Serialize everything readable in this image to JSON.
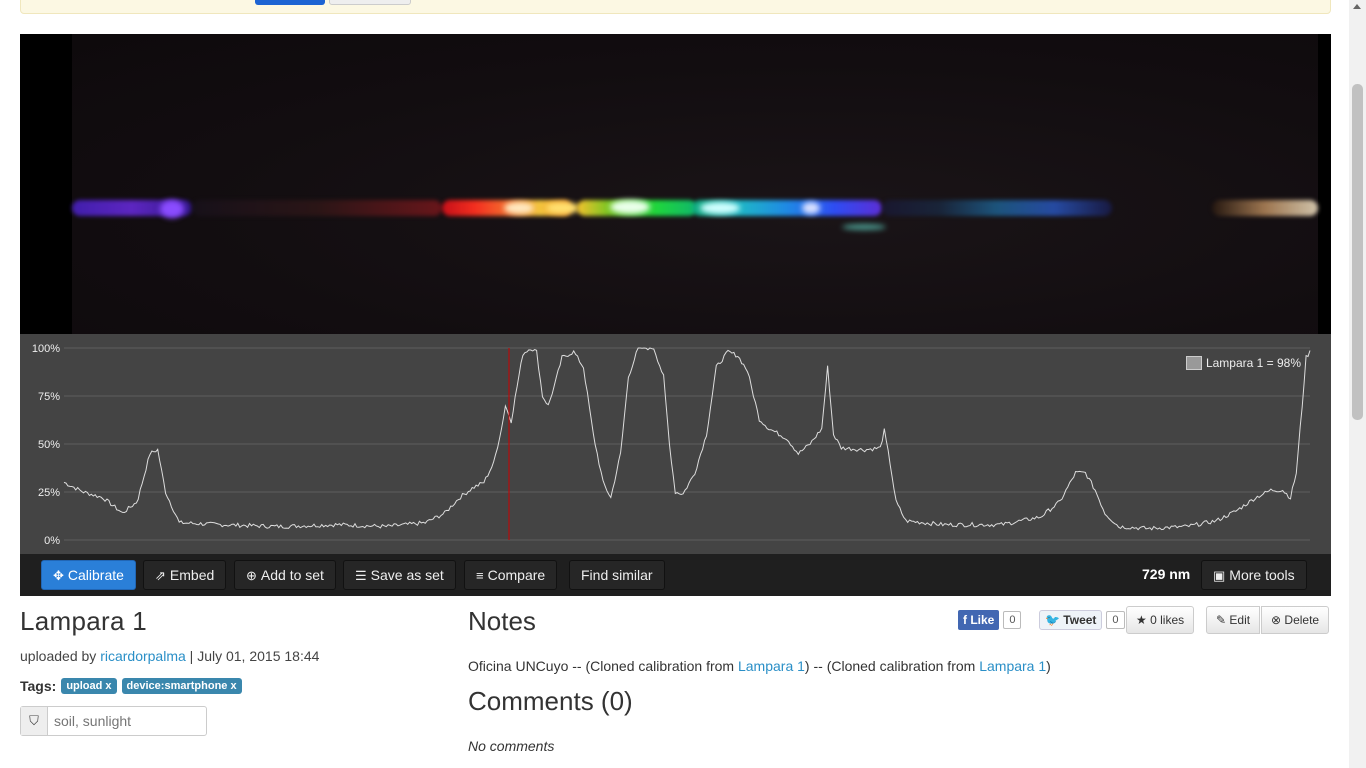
{
  "toolbar": {
    "calibrate": "Calibrate",
    "embed": "Embed",
    "add_to_set": "Add to set",
    "save_as_set": "Save as set",
    "compare": "Compare",
    "find_similar": "Find similar",
    "wavelength": "729 nm",
    "more_tools": "More tools"
  },
  "chart_data": {
    "type": "line",
    "series": [
      {
        "name": "Lampara 1"
      }
    ],
    "ylim": [
      0,
      100
    ],
    "yticks": [
      "100%",
      "75%",
      "50%",
      "25%",
      "0%"
    ],
    "legend": "Lampara 1 = 98%",
    "legend_position": "top-right",
    "grid": true,
    "marker_color": "#cc0000",
    "line_color": "#dddddd",
    "background": "#444444"
  },
  "spectrum": {
    "title": "Lampara 1",
    "uploaded_prefix": "uploaded by",
    "author": "ricardorpalma",
    "separator": "|",
    "date": "July 01, 2015 18:44",
    "tags_label": "Tags:",
    "tags": [
      "upload x",
      "device:smartphone x"
    ],
    "tag_placeholder": "soil, sunlight"
  },
  "notes": {
    "heading": "Notes",
    "text_1": "Oficina UNCuyo -- (Cloned calibration from",
    "link_1": "Lampara 1",
    "text_2": ") -- (Cloned calibration from",
    "link_2": "Lampara 1",
    "text_3": ")"
  },
  "comments": {
    "heading": "Comments (0)",
    "empty": "No comments"
  },
  "social": {
    "like": "Like",
    "like_count": "0",
    "tweet": "Tweet",
    "tweet_count": "0",
    "likes": "0 likes",
    "edit": "Edit",
    "delete": "Delete"
  }
}
